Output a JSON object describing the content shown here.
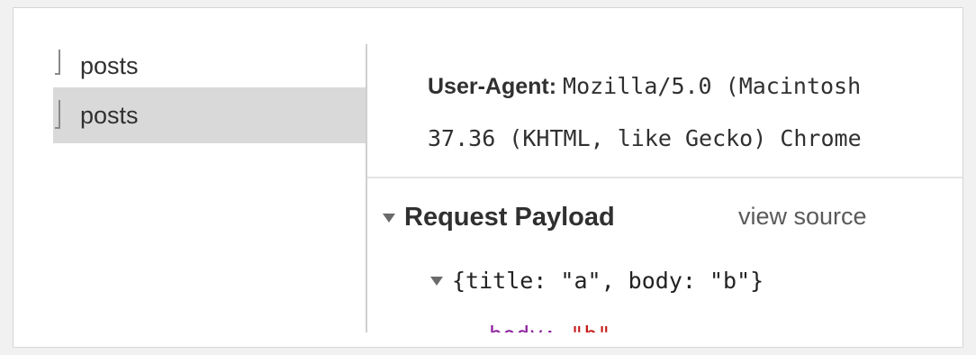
{
  "request_list": {
    "items": [
      {
        "name": "posts"
      },
      {
        "name": "posts"
      }
    ]
  },
  "headers": {
    "user_agent_key": "User-Agent:",
    "user_agent_value_line1": "Mozilla/5.0 (Macintosh",
    "user_agent_value_line2": "37.36 (KHTML, like Gecko) Chrome"
  },
  "payload": {
    "section_title": "Request Payload",
    "view_source_label": "view source",
    "summary": "{title: \"a\", body: \"b\"}",
    "partial_key": "body: ",
    "partial_value": "\"b\""
  },
  "colors": {
    "selected_row": "#d9d9d9",
    "property_key": "#8a1a9b",
    "string_value": "#c41a16"
  }
}
